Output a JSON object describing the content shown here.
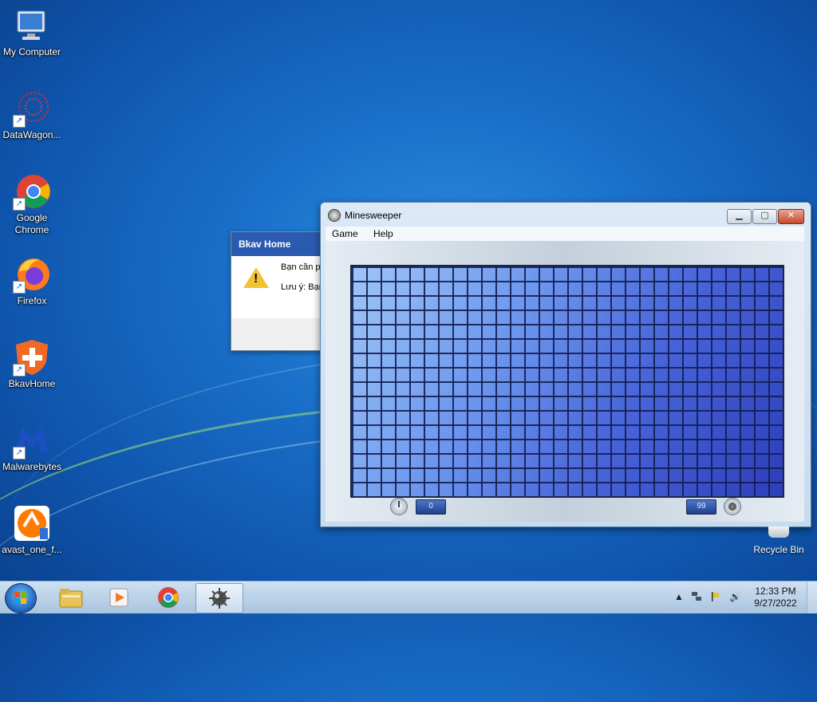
{
  "desktop": {
    "icons": [
      {
        "label": "My Computer"
      },
      {
        "label": "DataWagon..."
      },
      {
        "label": "Google Chrome"
      },
      {
        "label": "Firefox"
      },
      {
        "label": "BkavHome"
      },
      {
        "label": "Malwarebytes"
      },
      {
        "label": "avast_one_f..."
      }
    ],
    "recycle_bin": "Recycle Bin"
  },
  "bkav_dialog": {
    "title": "Bkav Home",
    "line1": "Bạn cần pl",
    "line2": "Lưu ý: Bạn"
  },
  "minesweeper": {
    "title": "Minesweeper",
    "menu": [
      "Game",
      "Help"
    ],
    "time": "0",
    "mines": "99",
    "grid": {
      "columns": 30,
      "rows": 16
    },
    "window_buttons": {
      "minimize": "▁",
      "maximize": "▢",
      "close": "✕"
    }
  },
  "taskbar": {
    "apps": [
      "file-explorer-icon",
      "media-player-icon",
      "chrome-icon",
      "minesweeper-icon"
    ],
    "time": "12:33 PM",
    "date": "9/27/2022"
  },
  "colors": {
    "accent": "#2b5bb0",
    "tile_light": "#9dc6f7",
    "tile_dark": "#2d3ebc"
  }
}
